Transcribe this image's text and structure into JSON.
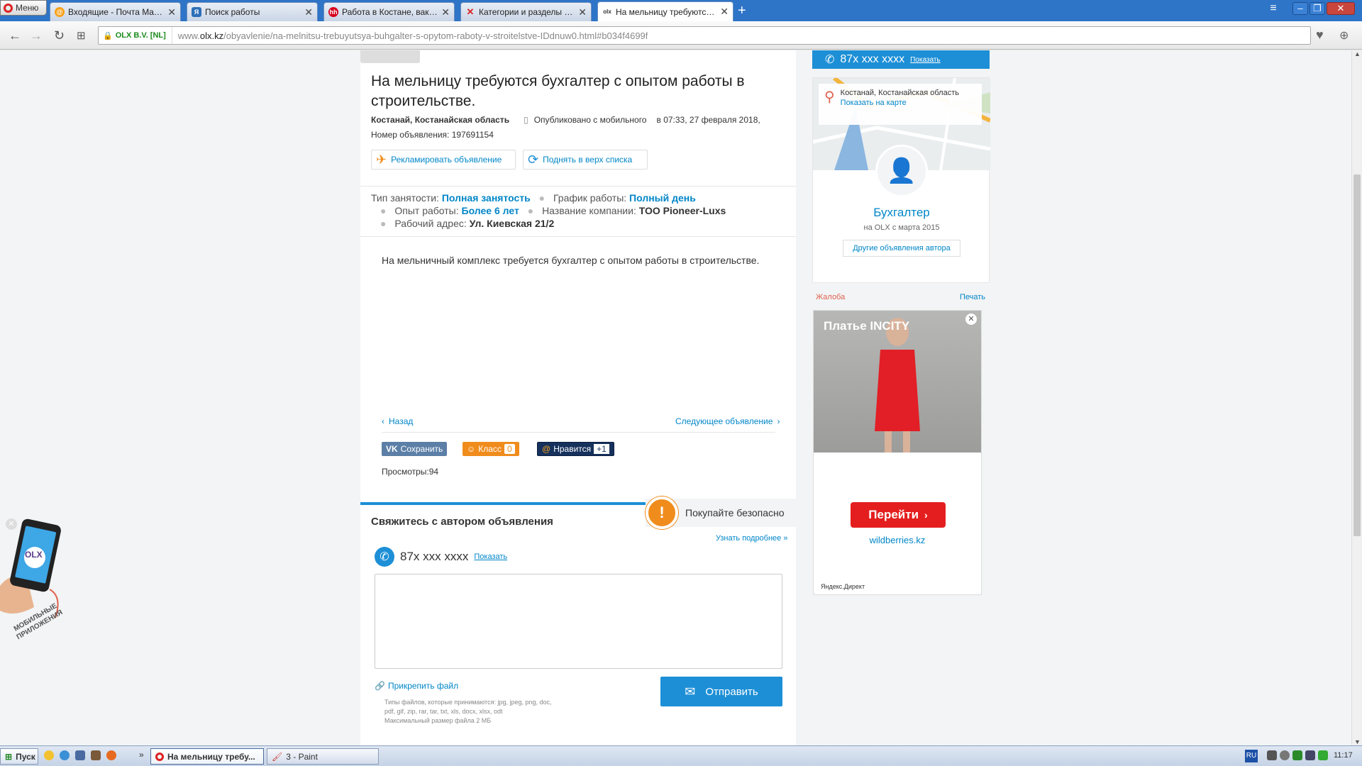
{
  "browser": {
    "menu_label": "Меню",
    "tabs": [
      {
        "title": "Входящие - Почта Mail.Ru",
        "favicon": "mail-icon"
      },
      {
        "title": "Поиск работы",
        "favicon": "search-work-icon"
      },
      {
        "title": "Работа в Костане, вакансии",
        "favicon": "hh-icon"
      },
      {
        "title": "Категории и разделы - Фор",
        "favicon": "cross-icon"
      },
      {
        "title": "На мельницу требуются бух",
        "favicon": "olx-icon"
      }
    ],
    "secure_label": "OLX B.V. [NL]",
    "url_prefix": "www.",
    "url_domain": "olx.kz",
    "url_path": "/obyavlenie/na-melnitsu-trebuyutsya-buhgalter-s-opytom-raboty-v-stroitelstve-IDdnuw0.html#b034f4699f"
  },
  "ad": {
    "title": "На мельницу требуются бухгалтер с опытом работы в строительстве.",
    "location": "Костанай, Костанайская область",
    "published": "Опубликовано с мобильного",
    "published_at": "в 07:33, 27 февраля 2018,",
    "ad_number": "Номер объявления: 197691154",
    "promote_label": "Рекламировать объявление",
    "raise_label": "Поднять в верх списка",
    "params": {
      "employment_type_label": "Тип занятости:",
      "employment_type": "Полная занятость",
      "schedule_label": "График работы:",
      "schedule": "Полный день",
      "experience_label": "Опыт работы:",
      "experience": "Более 6 лет",
      "company_label": "Название компании:",
      "company": "ТОО Pioneer-Luxs",
      "address_label": "Рабочий адрес:",
      "address": "Ул. Киевская 21/2"
    },
    "description": "На мельничный комплекс требуется бухгалтер с опытом работы в строительстве.",
    "back_label": "Назад",
    "next_label": "Следующее объявление",
    "vk_save": "Сохранить",
    "ok_class": "Класс",
    "ok_count": "0",
    "mail_like": "Нравится",
    "mail_plus": "+1",
    "views": "Просмотры:94"
  },
  "contact": {
    "heading": "Свяжитесь с автором объявления",
    "safe_label": "Покупайте безопасно",
    "learn_more": "Узнать подробнее »",
    "phone": "87x xxx xxxx",
    "show_label": "Показать",
    "message_value": "",
    "attach_label": "Прикрепить файл",
    "file_types": "Типы файлов, которые принимаются: jpg, jpeg, png, doc, pdf, gif, zip, rar, tar, txt, xls, docx, xlsx, odt",
    "max_size": "Максимальный размер файла 2 МБ",
    "send_label": "Отправить"
  },
  "sidebar": {
    "phone": "87x xxx xxxx",
    "show_label": "Показать",
    "map_location": "Костанай, Костанайская область",
    "show_on_map": "Показать на карте",
    "user_name": "Бухгалтер",
    "member_since": "на OLX с марта 2015",
    "other_ads": "Другие объявления автора",
    "complaint": "Жалоба",
    "print": "Печать"
  },
  "advert": {
    "title": "Платье INCITY",
    "cta": "Перейти",
    "domain": "wildberries.kz",
    "provider": "Яндекс.Директ"
  },
  "promo": {
    "label": "МОБИЛЬНЫЕ ПРИЛОЖЕНИЯ",
    "logo": "OLX"
  },
  "taskbar": {
    "start": "Пуск",
    "tasks": [
      "На мельницу требу...",
      "3 - Paint"
    ],
    "lang": "RU",
    "clock": "11:17"
  },
  "colors": {
    "olx_blue": "#1d8fd6",
    "link_blue": "#0086c8",
    "warning_orange": "#f08c1c",
    "ad_red": "#e41e1e"
  }
}
